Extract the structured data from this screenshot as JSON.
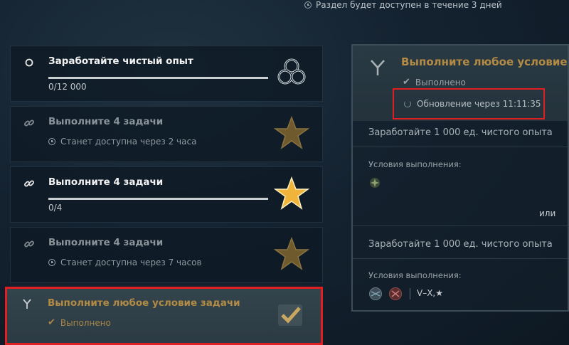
{
  "top": {
    "availability": "Раздел будет доступен в течение 3 дней"
  },
  "tasks": [
    {
      "title": "Заработайте чистый опыт",
      "progress": "0/12 000",
      "progress_fraction": 0
    },
    {
      "title": "Выполните 4 задачи",
      "status": "Станет доступна через 2 часа"
    },
    {
      "title": "Выполните 4 задачи",
      "progress": "0/4",
      "progress_fraction": 0
    },
    {
      "title": "Выполните 4 задачи",
      "status": "Станет доступна через 7 часов"
    },
    {
      "title": "Выполните любое условие задачи",
      "status": "Выполнено"
    }
  ],
  "panel": {
    "title": "Выполните любое условие за",
    "status": "Выполнено",
    "update": "Обновление через 11:11:35",
    "condition1": "Заработайте 1 000 ед. чистого опыта",
    "conditions_label1": "Условия выполнения:",
    "or": "или",
    "condition2": "Заработайте 1 000 ед. чистого опыта",
    "conditions_label2": "Условия выполнения:",
    "tiers": "V–X,★"
  },
  "colors": {
    "gold": "#b38b44",
    "highlight": "#e02020",
    "star": "#f0b43a"
  }
}
